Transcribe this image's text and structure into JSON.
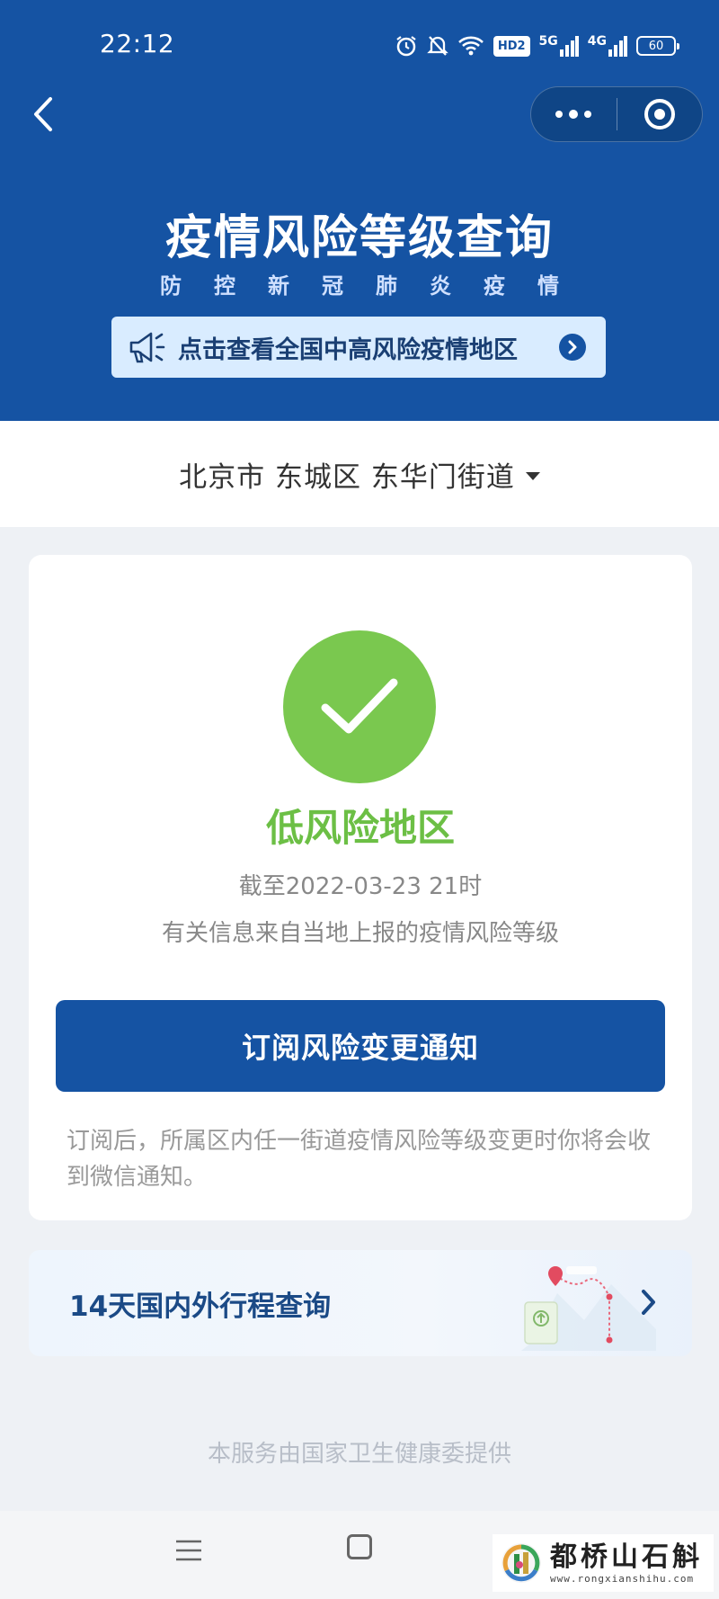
{
  "status_bar": {
    "time": "22:12",
    "network_5g": "5G",
    "network_4g": "4G",
    "hd": "HD2",
    "battery": "60"
  },
  "header": {
    "title": "疫情风险等级查询",
    "subtitle": "防控新冠肺炎疫情",
    "banner_text": "点击查看全国中高风险疫情地区"
  },
  "location": {
    "text": "北京市 东城区 东华门街道"
  },
  "result": {
    "risk_level": "低风险地区",
    "as_of": "截至2022-03-23 21时",
    "source_note": "有关信息来自当地上报的疫情风险等级",
    "subscribe_label": "订阅风险变更通知",
    "subscribe_note": "订阅后，所属区内任一街道疫情风险等级变更时你将会收到微信通知。"
  },
  "travel": {
    "label": "14天国内外行程查询"
  },
  "footer": {
    "provider": "本服务由国家卫生健康委提供"
  },
  "watermark": {
    "name": "都桥山石斛",
    "url": "www.rongxianshihu.com"
  },
  "colors": {
    "header_blue": "#1553a3",
    "low_risk_green": "#7ac84f",
    "banner_bg": "#d9ecff"
  },
  "icons": [
    "back-arrow-icon",
    "more-dots-icon",
    "target-icon",
    "megaphone-icon",
    "chevron-right-icon",
    "check-icon",
    "menu-icon",
    "home-square-icon",
    "alarm-icon",
    "mute-bell-icon",
    "wifi-icon",
    "signal-icon"
  ]
}
